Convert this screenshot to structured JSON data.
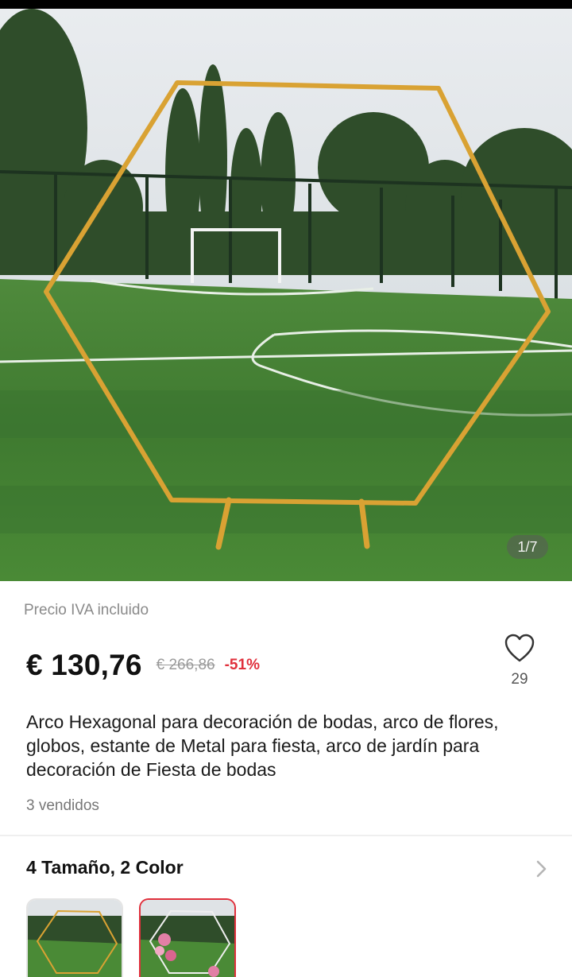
{
  "gallery": {
    "counter": "1/7"
  },
  "price_block": {
    "tax_note": "Precio IVA incluido",
    "current_price": "€ 130,76",
    "original_price": "€ 266,86",
    "discount": "-51%"
  },
  "wishlist": {
    "icon": "heart-outline-icon",
    "count": "29"
  },
  "product": {
    "title": "Arco Hexagonal para decoración de bodas, arco de flores, globos, estante de Metal para fiesta, arco de jardín para decoración de Fiesta de bodas",
    "sold": "3 vendidos"
  },
  "variants": {
    "label": "4 Tamaño, 2 Color",
    "icon": "chevron-right-icon"
  },
  "colors": {
    "accent": "#e0303c",
    "price_text": "#111111",
    "muted_text": "#8a8a8a",
    "frame_gold": "#d9a233"
  }
}
